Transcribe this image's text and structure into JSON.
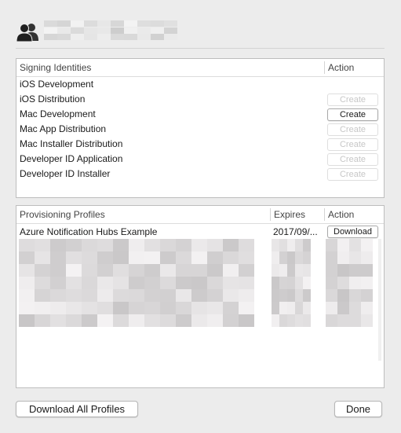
{
  "account": {
    "name_redacted": true
  },
  "signing_identities": {
    "header": "Signing Identities",
    "action_header": "Action",
    "rows": [
      {
        "name": "iOS Development",
        "button": null,
        "enabled": false
      },
      {
        "name": "iOS Distribution",
        "button": "Create",
        "enabled": false
      },
      {
        "name": "Mac Development",
        "button": "Create",
        "enabled": true
      },
      {
        "name": "Mac App Distribution",
        "button": "Create",
        "enabled": false
      },
      {
        "name": "Mac Installer Distribution",
        "button": "Create",
        "enabled": false
      },
      {
        "name": "Developer ID Application",
        "button": "Create",
        "enabled": false
      },
      {
        "name": "Developer ID Installer",
        "button": "Create",
        "enabled": false
      }
    ]
  },
  "provisioning_profiles": {
    "header": "Provisioning Profiles",
    "expires_header": "Expires",
    "action_header": "Action",
    "rows": [
      {
        "name": "Azure Notification Hubs Example",
        "expires": "2017/09/...",
        "button": "Download"
      }
    ]
  },
  "footer": {
    "download_all_label": "Download All Profiles",
    "done_label": "Done"
  },
  "colors": {
    "background": "#ececec",
    "panel": "#ffffff",
    "border": "#bdbdbd"
  }
}
